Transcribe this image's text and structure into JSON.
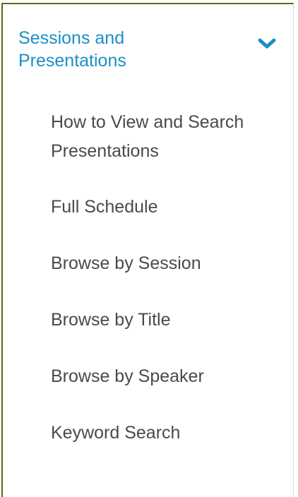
{
  "section": {
    "title": "Sessions and Presentations",
    "expanded_icon": "chevron-down-icon",
    "accent_color": "#1b8fc7"
  },
  "menu": {
    "items": [
      {
        "label": "How to View and Search Presentations"
      },
      {
        "label": "Full Schedule"
      },
      {
        "label": "Browse by Session"
      },
      {
        "label": "Browse by Title"
      },
      {
        "label": "Browse by Speaker"
      },
      {
        "label": "Keyword Search"
      }
    ]
  }
}
